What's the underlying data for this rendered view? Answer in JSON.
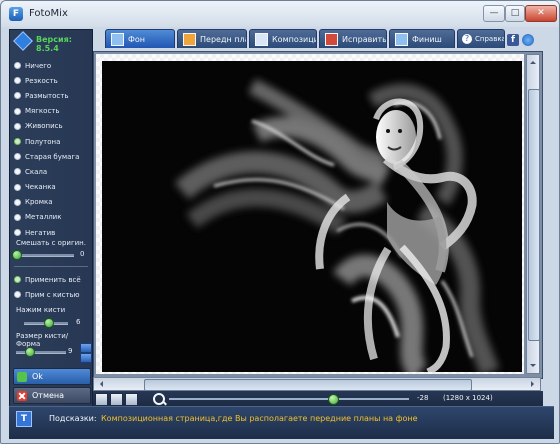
{
  "window": {
    "title": "FotoMix",
    "minimize_label": "—",
    "maximize_label": "□",
    "close_label": "✕"
  },
  "sidebar": {
    "version": "Версия: 8.5.4",
    "items": [
      {
        "label": "Ничего",
        "selected": false
      },
      {
        "label": "Резкость",
        "selected": false
      },
      {
        "label": "Размытость",
        "selected": false
      },
      {
        "label": "Мягкость",
        "selected": false
      },
      {
        "label": "Живопись",
        "selected": false
      },
      {
        "label": "Полутона",
        "selected": true
      },
      {
        "label": "Старая бумага",
        "selected": false
      },
      {
        "label": "Скала",
        "selected": false
      },
      {
        "label": "Чеканка",
        "selected": false
      },
      {
        "label": "Кромка",
        "selected": false
      },
      {
        "label": "Металлик",
        "selected": false
      },
      {
        "label": "Негатив",
        "selected": false
      }
    ],
    "mix_label": "Смешать с оригин.",
    "mix_value": "0",
    "mix_level": 0.0,
    "apply_all_label": "Применить всё",
    "apply_brush_label": "Прим с кистью",
    "pressure_label": "Нажим кисти",
    "pressure_value": "6",
    "pressure_level": 0.55,
    "brush_size_label": "Размер кисти/Форма",
    "brush_size_value": "9",
    "brush_size_level": 0.25,
    "ok_label": "Ok",
    "cancel_label": "Отмена"
  },
  "tabs": [
    {
      "label": "Фон",
      "icon": "background-icon",
      "active": true
    },
    {
      "label": "Передн план",
      "icon": "foreground-icon",
      "active": false
    },
    {
      "label": "Композиция",
      "icon": "composition-icon",
      "active": false
    },
    {
      "label": "Исправить",
      "icon": "fix-icon",
      "active": false
    },
    {
      "label": "Финиш",
      "icon": "finish-icon",
      "active": false
    }
  ],
  "help_label": "Справка",
  "bottom_bar": {
    "zoom_value": "-28",
    "zoom_level": 0.68,
    "image_size": "(1280 x 1024)"
  },
  "hint": {
    "label": "Подсказки:",
    "text": "Композиционная страница,где Вы располагаете передние планы на фоне"
  },
  "colors": {
    "accent": "#2156b3",
    "version_green": "#58d35a",
    "hint_yellow": "#f1c02d"
  }
}
